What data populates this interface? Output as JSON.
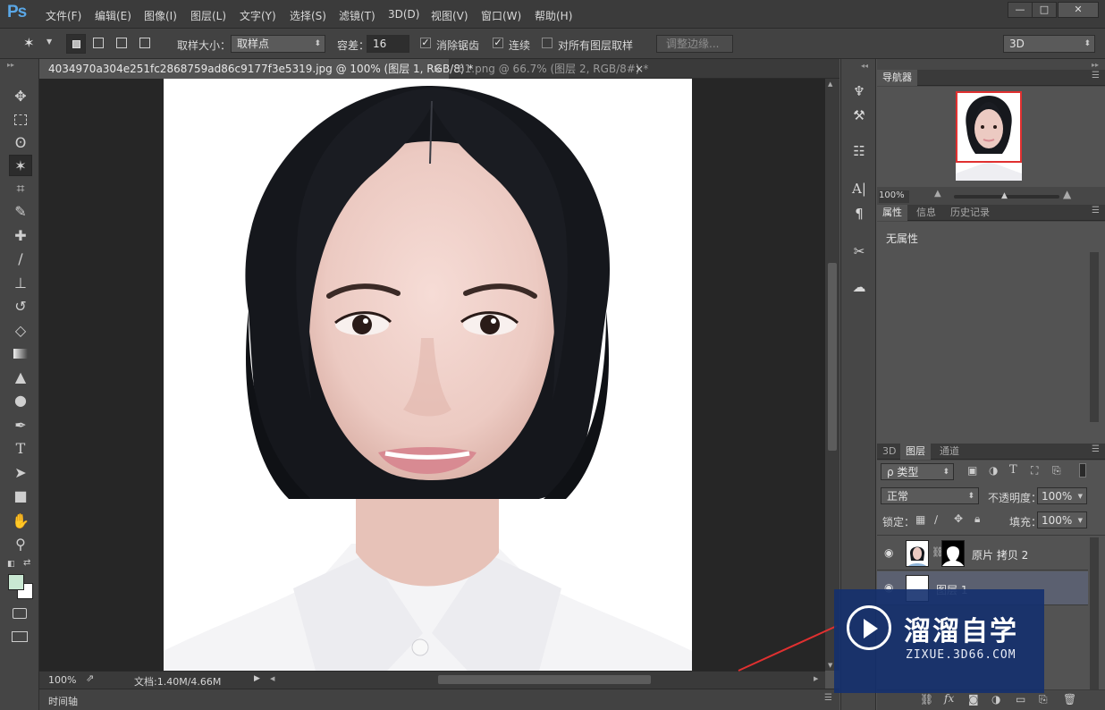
{
  "app": {
    "logo": "Ps"
  },
  "menu": [
    "文件(F)",
    "编辑(E)",
    "图像(I)",
    "图层(L)",
    "文字(Y)",
    "选择(S)",
    "滤镜(T)",
    "3D(D)",
    "视图(V)",
    "窗口(W)",
    "帮助(H)"
  ],
  "window_controls": {
    "minimize": "—",
    "maximize": "□",
    "close": "✕"
  },
  "options": {
    "sample_size_label": "取样大小：",
    "sample_size_value": "取样点",
    "tolerance_label": "容差：",
    "tolerance_value": "16",
    "antialias_label": "消除锯齿",
    "contiguous_label": "连续",
    "all_layers_label": "对所有图层取样",
    "refine_edge_label": "调整边缘...",
    "workspace_value": "3D"
  },
  "tabs": [
    {
      "label": "4034970a304e251fc2868759ad86c9177f3e5319.jpg @ 100% (图层 1, RGB/8) *",
      "close": "×"
    },
    {
      "label": "61.png @ 66.7% (图层 2, RGB/8#) *",
      "close": "×"
    }
  ],
  "status": {
    "zoom": "100%",
    "doc_info": "文档:1.40M/4.66M"
  },
  "timeline": {
    "label": "时间轴"
  },
  "navigator": {
    "tab": "导航器",
    "zoom": "100%"
  },
  "properties": {
    "tabs": [
      "属性",
      "信息",
      "历史记录"
    ],
    "content": "无属性"
  },
  "layers_panel": {
    "tabs": [
      "3D",
      "图层",
      "通道"
    ],
    "filter": "ρ 类型",
    "blend_mode": "正常",
    "opacity_label": "不透明度：",
    "opacity_value": "100%",
    "lock_label": "锁定：",
    "fill_label": "填充：",
    "fill_value": "100%",
    "layers": [
      {
        "name": "原片 拷贝 2"
      },
      {
        "name": "图层 1"
      }
    ]
  },
  "watermark": {
    "title": "溜溜自学",
    "url": "ZIXUE.3D66.COM"
  },
  "colors": {
    "foreground": "#c9e8d2",
    "background": "#ffffff",
    "accent_arrow": "#e03030"
  }
}
